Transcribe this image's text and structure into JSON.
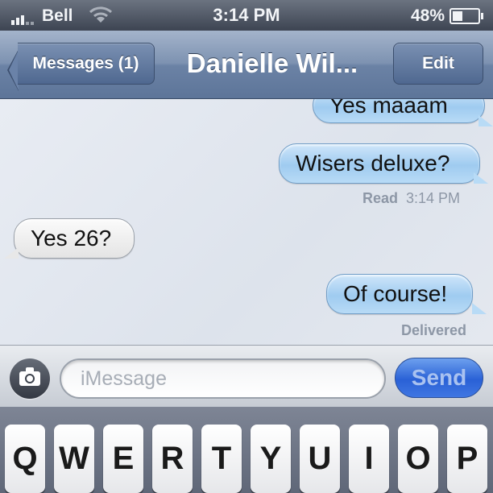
{
  "status_bar": {
    "carrier": "Bell",
    "time": "3:14 PM",
    "battery_percent": "48%",
    "battery_level": 0.48
  },
  "nav": {
    "back_label": "Messages (1)",
    "title": "Danielle Wil...",
    "edit_label": "Edit"
  },
  "messages": [
    {
      "direction": "outgoing",
      "text": "Yes maaam"
    },
    {
      "direction": "outgoing",
      "text": "Wisers deluxe?"
    },
    {
      "direction": "incoming",
      "text": "Yes 26?"
    },
    {
      "direction": "outgoing",
      "text": "Of course!"
    }
  ],
  "read_receipt": {
    "label": "Read",
    "time": "3:14 PM"
  },
  "delivered_label": "Delivered",
  "composer": {
    "placeholder": "iMessage",
    "value": "",
    "send_label": "Send",
    "camera_icon": "camera-icon"
  },
  "keyboard": {
    "row1": [
      "Q",
      "W",
      "E",
      "R",
      "T",
      "Y",
      "U",
      "I",
      "O",
      "P"
    ]
  },
  "colors": {
    "outgoing_bubble": "#a9d1f3",
    "incoming_bubble": "#ececec",
    "navbar": "#7d92b1",
    "send_button": "#2a61d6"
  }
}
